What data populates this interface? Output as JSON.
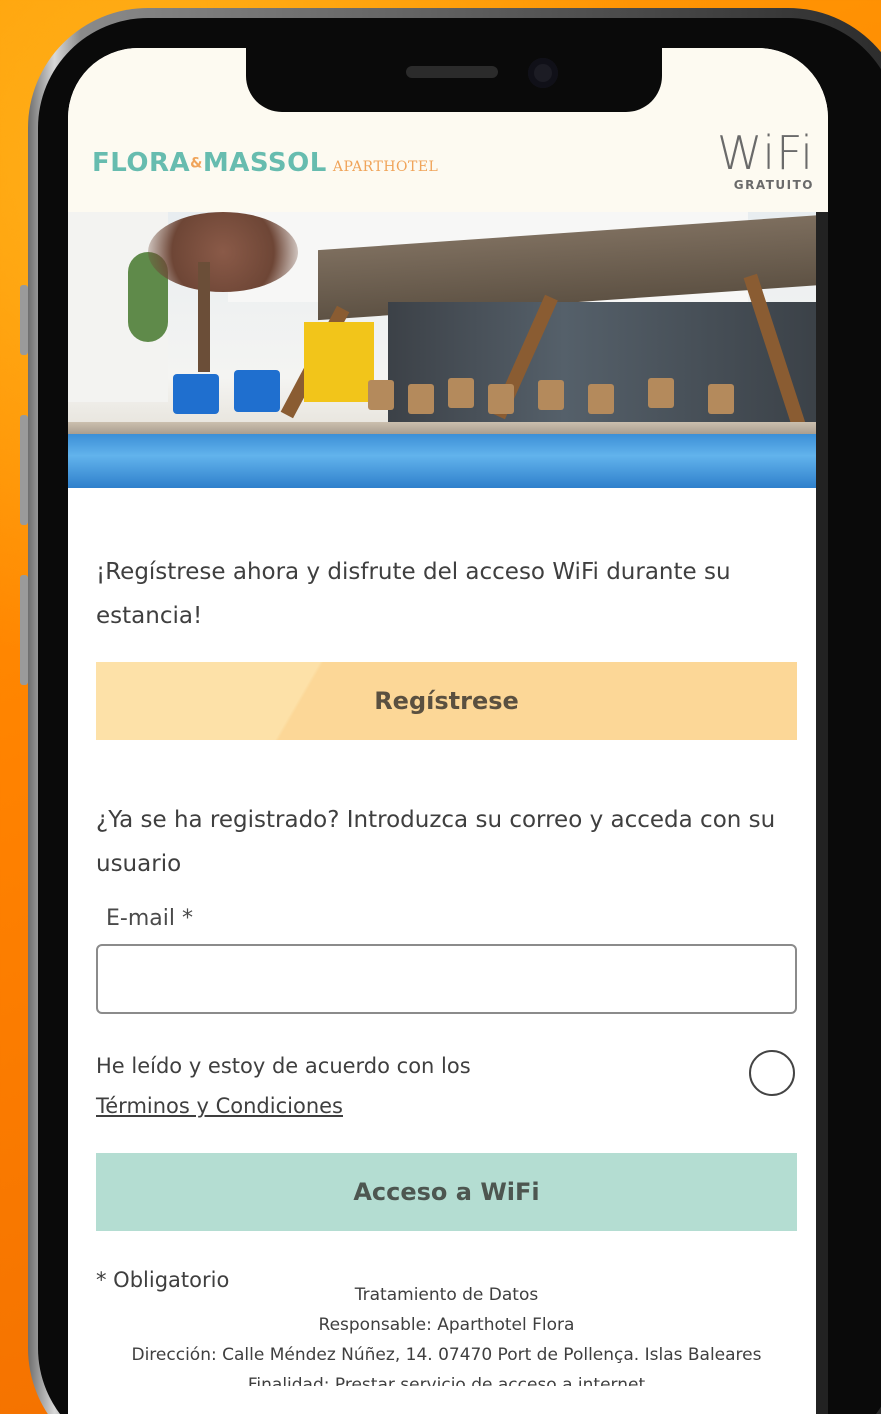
{
  "brand": {
    "logo_main": "FLORA",
    "logo_amp": "&",
    "logo_second": "MASSOL",
    "logo_sub": "APARTHOTEL",
    "wifi_word": "WiFi",
    "wifi_sub": "GRATUITO"
  },
  "intro_text": "¡Regístrese ahora y disfrute del acceso WiFi durante su estancia!",
  "register_button": "Regístrese",
  "login_heading": "¿Ya se ha registrado? Introduzca su correo y acceda con su usuario",
  "email": {
    "label": "E-mail *",
    "value": "",
    "placeholder": ""
  },
  "terms": {
    "text": "He leído y estoy de acuerdo con los",
    "link": "Términos y Condiciones",
    "checked": false
  },
  "access_button": "Acceso a WiFi",
  "required_note": "* Obligatorio",
  "legal": {
    "title": "Tratamiento de Datos",
    "responsible": "Responsable: Aparthotel Flora",
    "address": "Dirección: Calle Méndez Núñez, 14. 07470 Port de Pollença. Islas Baleares",
    "purpose": "Finalidad: Prestar servicio de acceso a internet"
  },
  "colors": {
    "background": "#ff8a00",
    "logo_teal": "#67bcaf",
    "logo_orange": "#f0a45a",
    "register_button": "#fcd797",
    "access_button": "#b4ddd2"
  }
}
